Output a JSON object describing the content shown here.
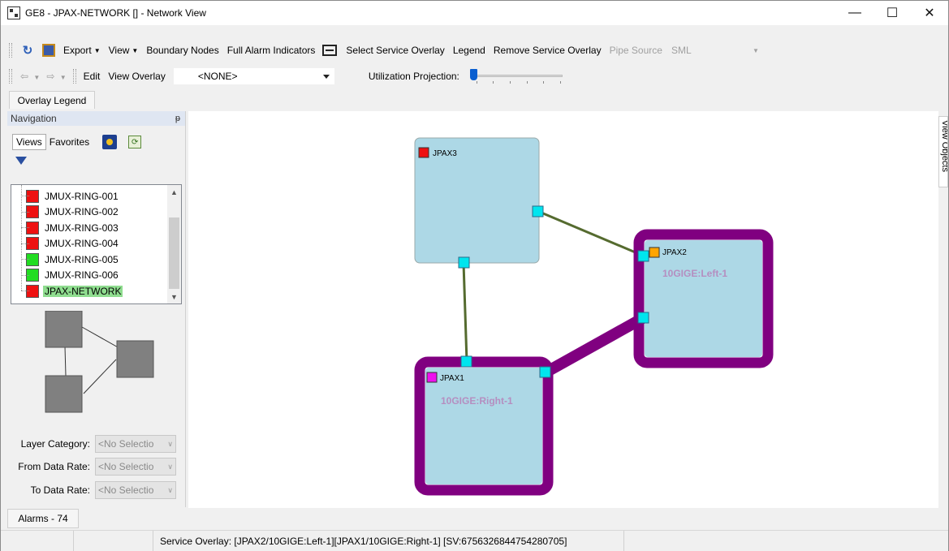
{
  "window": {
    "title": "GE8 - JPAX-NETWORK [] - Network View",
    "minimize": "—",
    "maximize": "☐",
    "close": "✕"
  },
  "toolbar1": {
    "export": "Export",
    "view": "View",
    "boundary_nodes": "Boundary Nodes",
    "full_alarm_indicators": "Full Alarm Indicators",
    "select_service_overlay": "Select Service Overlay",
    "legend": "Legend",
    "remove_service_overlay": "Remove Service Overlay",
    "pipe_source": "Pipe Source",
    "sml": "SML"
  },
  "toolbar2": {
    "back_arrow": "⇦",
    "forward_arrow": "⇨",
    "edit": "Edit",
    "view_overlay": "View Overlay",
    "overlay_value": "<NONE>",
    "utilization_projection": "Utilization Projection:",
    "utilization_value": 0
  },
  "overlay_legend_tab": "Overlay Legend",
  "navigation": {
    "title": "Navigation",
    "pin": "ᵽ",
    "tabs": [
      "Views",
      "Favorites"
    ],
    "tree": [
      {
        "label": "JMUX-RING-001",
        "status_color": "#ee1111"
      },
      {
        "label": "JMUX-RING-002",
        "status_color": "#ee1111"
      },
      {
        "label": "JMUX-RING-003",
        "status_color": "#ee1111"
      },
      {
        "label": "JMUX-RING-004",
        "status_color": "#ee1111"
      },
      {
        "label": "JMUX-RING-005",
        "status_color": "#22dd22"
      },
      {
        "label": "JMUX-RING-006",
        "status_color": "#22dd22"
      },
      {
        "label": "JPAX-NETWORK",
        "status_color": "#ee1111",
        "selected": true
      }
    ],
    "filters": [
      {
        "label": "Layer Category:",
        "value": "<No Selectio"
      },
      {
        "label": "From Data Rate:",
        "value": "<No Selectio"
      },
      {
        "label": "To Data Rate:",
        "value": "<No Selectio"
      }
    ]
  },
  "canvas": {
    "nodes": [
      {
        "name": "JPAX3",
        "status_color": "#ee1111",
        "port_label": ""
      },
      {
        "name": "JPAX2",
        "status_color": "#ffa500",
        "port_label": "10GIGE:Left-1"
      },
      {
        "name": "JPAX1",
        "status_color": "#ee11ee",
        "port_label": "10GIGE:Right-1"
      }
    ],
    "overlay_color": "#800080",
    "node_fill": "#add8e6",
    "port_fill": "#00e5ee",
    "link_color": "#556b2f"
  },
  "view_objects_tab": "View Objects",
  "alarms_tab": "Alarms - 74",
  "status": {
    "service_overlay": "Service Overlay: [JPAX2/10GIGE:Left-1][JPAX1/10GIGE:Right-1] [SV:6756326844754280705]"
  }
}
